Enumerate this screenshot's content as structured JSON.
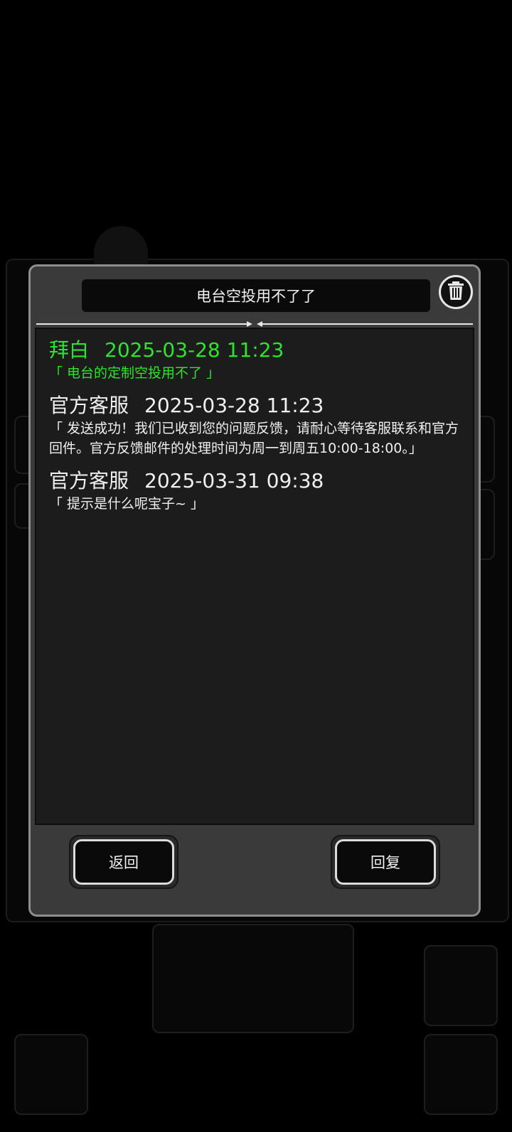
{
  "dialog": {
    "title": "电台空投用不了了"
  },
  "messages": [
    {
      "sender": "拜白",
      "time": "2025-03-28 11:23",
      "text": "「 电台的定制空投用不了 」",
      "mine": true
    },
    {
      "sender": "官方客服",
      "time": "2025-03-28 11:23",
      "text": "「 发送成功！我们已收到您的问题反馈，请耐心等待客服联系和官方回件。官方反馈邮件的处理时间为周一到周五10:00-18:00。」",
      "mine": false
    },
    {
      "sender": "官方客服",
      "time": "2025-03-31 09:38",
      "text": "「 提示是什么呢宝子~ 」",
      "mine": false
    }
  ],
  "buttons": {
    "back": "返回",
    "reply": "回复"
  },
  "icons": {
    "delete": "trash-icon"
  },
  "colors": {
    "mine_text": "#2fe32f",
    "other_text": "#f0f0f0"
  }
}
